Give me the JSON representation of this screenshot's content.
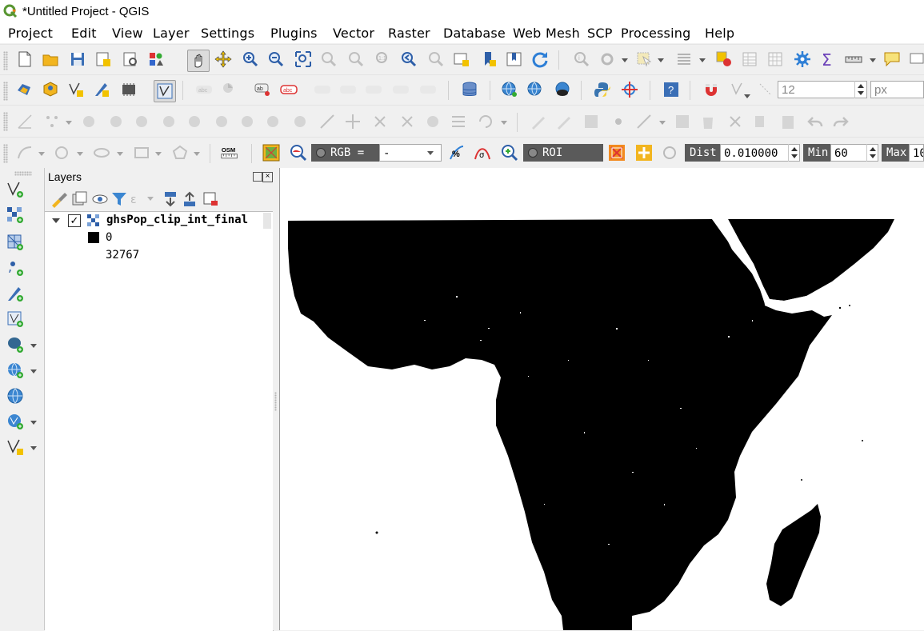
{
  "window": {
    "title": "*Untitled Project - QGIS",
    "app_icon": "qgis-logo-icon"
  },
  "menu": [
    "Project",
    "Edit",
    "View",
    "Layer",
    "Settings",
    "Plugins",
    "Vector",
    "Raster",
    "Database",
    "Web",
    "Mesh",
    "SCP",
    "Processing",
    "Help"
  ],
  "toolbar_label": {
    "osm": "OSM",
    "annotation_size_value": "12",
    "annotation_unit": "px"
  },
  "scp": {
    "rgb_label": "RGB =",
    "rgb_value": "-",
    "roi_label": "ROI",
    "dist_label": "Dist",
    "dist_value": "0.010000",
    "min_label": "Min",
    "min_value": "60",
    "max_label": "Max",
    "max_value": "10"
  },
  "layers_panel": {
    "title": "Layers",
    "layer": {
      "name": "ghsPop_clip_int_final",
      "checked": true,
      "legend": [
        {
          "label": "0",
          "color": "#000000"
        },
        {
          "label": "32767",
          "color": "#ffffff"
        }
      ]
    }
  },
  "colors": {
    "accent_green": "#589632",
    "raster": "#000000",
    "canvas_bg": "#ffffff"
  }
}
